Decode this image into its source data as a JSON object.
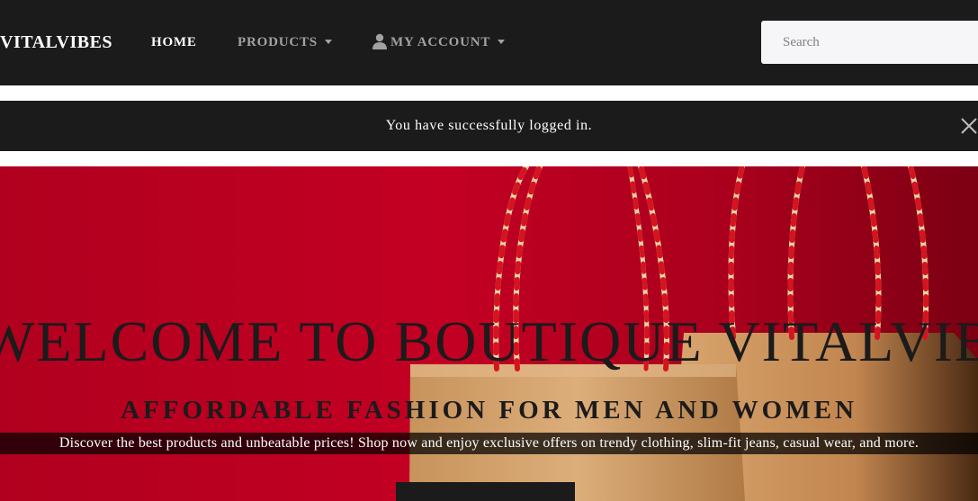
{
  "navbar": {
    "brand": "VITALVIBES",
    "links": {
      "home": "HOME",
      "products": "PRODUCTS",
      "account": "MY ACCOUNT"
    },
    "search": {
      "placeholder": "Search",
      "value": ""
    }
  },
  "alert": {
    "message": "You have successfully logged in."
  },
  "hero": {
    "title": "WELCOME TO BOUTIQUE VITALVIBES",
    "subtitle": "AFFORDABLE FASHION FOR MEN AND WOMEN",
    "description": "Discover the best products and unbeatable prices! Shop now and enjoy exclusive offers on trendy clothing, slim-fit jeans, casual wear, and more.",
    "button_label": ""
  },
  "icons": {
    "user": "user-icon",
    "caret": "caret-down-icon",
    "close": "close-icon"
  },
  "colors": {
    "navbar_bg": "#1b1b1b",
    "nav_active": "#ffffff",
    "nav_inactive": "#a2a2a2",
    "hero_red": "#c10022",
    "search_bg": "#f6f6f8"
  }
}
